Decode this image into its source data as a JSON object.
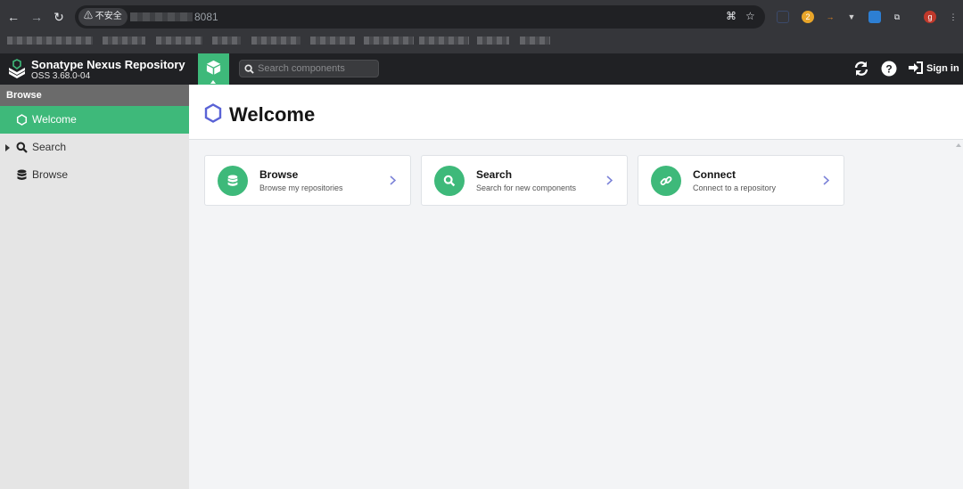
{
  "browser": {
    "security_label": "不安全",
    "url_visible": "8081"
  },
  "app": {
    "name": "Sonatype Nexus Repository",
    "version": "OSS 3.68.0-04",
    "search_placeholder": "Search components",
    "sign_in_label": "Sign in"
  },
  "sidebar": {
    "header": "Browse",
    "items": [
      {
        "label": "Welcome",
        "icon": "hexagon-icon",
        "active": true
      },
      {
        "label": "Search",
        "icon": "search-icon",
        "expandable": true
      },
      {
        "label": "Browse",
        "icon": "database-icon"
      }
    ]
  },
  "main": {
    "title": "Welcome",
    "cards": [
      {
        "title": "Browse",
        "subtitle": "Browse my repositories",
        "icon": "database-icon"
      },
      {
        "title": "Search",
        "subtitle": "Search for new components",
        "icon": "search-icon"
      },
      {
        "title": "Connect",
        "subtitle": "Connect to a repository",
        "icon": "link-icon"
      }
    ]
  },
  "colors": {
    "accent": "#3eb97a",
    "header_bg": "#202124",
    "sidebar_bg": "#e5e5e5",
    "hexagon": "#5a63d6"
  }
}
